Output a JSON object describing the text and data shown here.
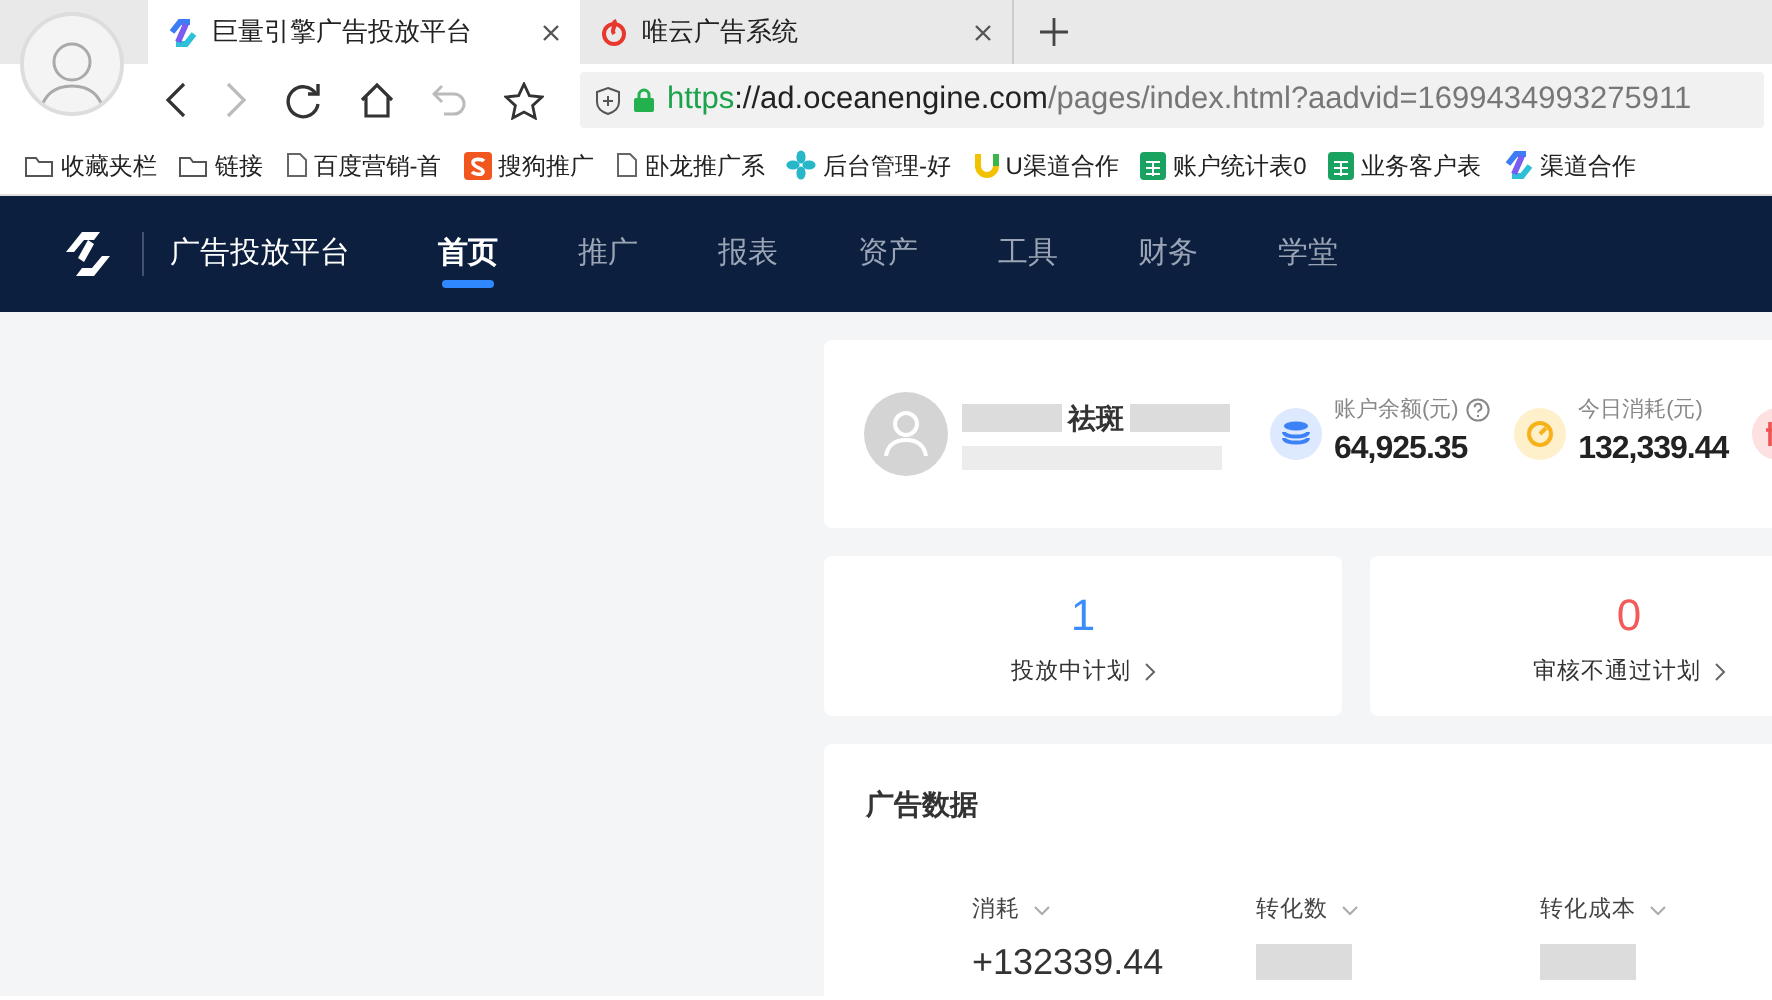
{
  "browser": {
    "tabs": [
      {
        "title": "巨量引擎广告投放平台",
        "kind": "ocean",
        "selected": true
      },
      {
        "title": "唯云广告系统",
        "kind": "weiyun",
        "selected": false
      }
    ],
    "url": {
      "scheme": "https",
      "host": "://ad.oceanengine.com",
      "path": "/pages/index.html?aadvid=1699434993275911"
    },
    "bookmarks": [
      {
        "label": "收藏夹栏",
        "kind": "folder"
      },
      {
        "label": "链接",
        "kind": "folder"
      },
      {
        "label": "百度营销-首",
        "kind": "page"
      },
      {
        "label": "搜狗推广",
        "kind": "sogou"
      },
      {
        "label": "卧龙推广系",
        "kind": "page"
      },
      {
        "label": "后台管理-好",
        "kind": "fan"
      },
      {
        "label": "U渠道合作",
        "kind": "u"
      },
      {
        "label": "账户统计表0",
        "kind": "sheet"
      },
      {
        "label": "业务客户表",
        "kind": "sheet"
      },
      {
        "label": "渠道合作",
        "kind": "ocean"
      }
    ]
  },
  "app": {
    "brand": "广告投放平台",
    "nav": [
      {
        "label": "首页",
        "selected": true
      },
      {
        "label": "推广",
        "selected": false
      },
      {
        "label": "报表",
        "selected": false
      },
      {
        "label": "资产",
        "selected": false
      },
      {
        "label": "工具",
        "selected": false
      },
      {
        "label": "财务",
        "selected": false
      },
      {
        "label": "学堂",
        "selected": false
      }
    ]
  },
  "account": {
    "name": "祛斑",
    "stats": [
      {
        "kind": "balance",
        "label": "账户余额(元)",
        "help": true,
        "value": "64,925.35"
      },
      {
        "kind": "spend",
        "label": "今日消耗(元)",
        "help": false,
        "value": "132,339.44"
      },
      {
        "kind": "budget"
      }
    ]
  },
  "summary": [
    {
      "count": "1",
      "label": "投放中计划",
      "color": "#3d8bfd"
    },
    {
      "count": "0",
      "label": "审核不通过计划",
      "color": "#f35b5b"
    }
  ],
  "ad_data": {
    "title": "广告数据",
    "metrics": [
      {
        "label": "消耗",
        "value": "+132339.44"
      },
      {
        "label": "转化数"
      },
      {
        "label": "转化成本"
      }
    ]
  }
}
